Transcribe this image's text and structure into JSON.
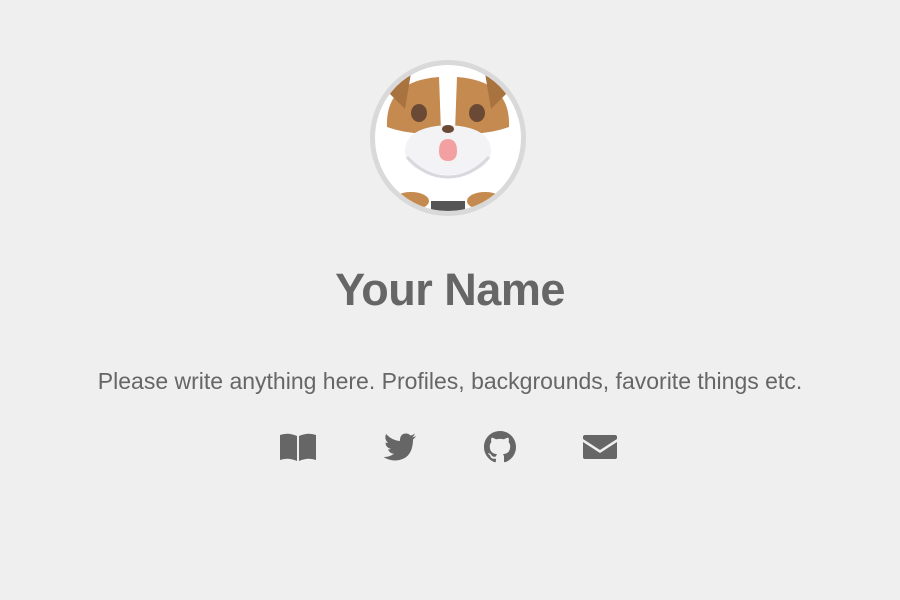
{
  "profile": {
    "name": "Your Name",
    "bio": "Please write anything here. Profiles, backgrounds, favorite things etc.",
    "avatar_icon": "bulldog-avatar"
  },
  "links": [
    {
      "icon": "book-icon"
    },
    {
      "icon": "twitter-icon"
    },
    {
      "icon": "github-icon"
    },
    {
      "icon": "envelope-icon"
    }
  ],
  "colors": {
    "background": "#efefef",
    "text": "#666666",
    "icon": "#666666",
    "avatar_border": "#d9d9d9",
    "dog_brown": "#c48a4f",
    "dog_nose": "#6b4a35",
    "dog_tongue": "#f3a0a3"
  }
}
